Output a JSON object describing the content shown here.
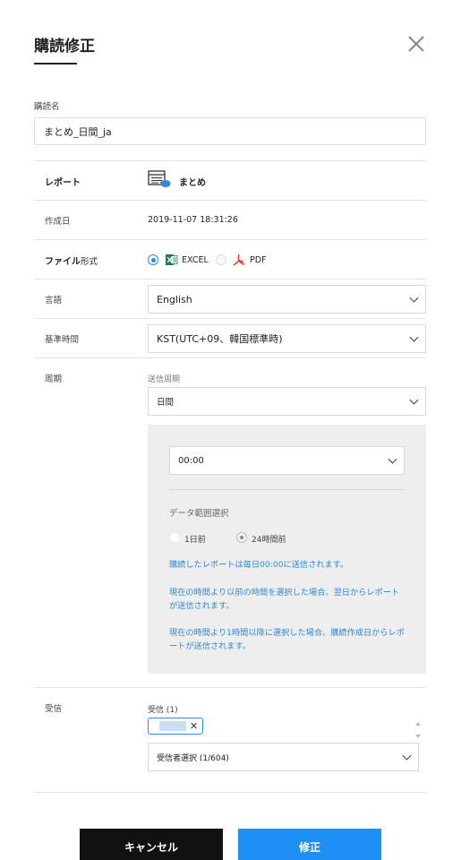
{
  "dialog": {
    "title": "購読修正"
  },
  "name_field": {
    "label": "購読名",
    "value": "まとめ_日間_ja"
  },
  "report_row": {
    "label": "レポート",
    "value": "まとめ"
  },
  "created_row": {
    "label": "作成日",
    "value": "2019-11-07 18:31:26"
  },
  "file_format_row": {
    "label_bold": "ファイル",
    "label_rest": "形式",
    "options": [
      {
        "label": "EXCEL",
        "selected": true
      },
      {
        "label": "PDF",
        "selected": false
      }
    ]
  },
  "language_row": {
    "label": "言語",
    "value": "English"
  },
  "timezone_row": {
    "label": "基準時間",
    "value": "KST(UTC+09、韓国標準時)"
  },
  "period_row": {
    "label": "周期",
    "cycle_label": "送信周期",
    "cycle_value": "日間",
    "time_value": "00:00",
    "range_label": "データ範囲選択",
    "range_options": [
      {
        "label": "1日前",
        "selected": false
      },
      {
        "label": "24時間前",
        "selected": true
      }
    ],
    "info": [
      "購読したレポートは毎日00:00に送信されます。",
      "現在の時間より以前の時間を選択した場合、翌日からレポートが送信されます。",
      "現在の時間より1時間以降に選択した場合、購読作成日からレポートが送信されます。"
    ]
  },
  "recipient_row": {
    "label": "受信",
    "count_label": "受信 (1)",
    "select_value": "受信者選択 (1/604)"
  },
  "buttons": {
    "cancel": "キャンセル",
    "submit": "修正"
  },
  "colors": {
    "accent": "#1e8ff5",
    "info_text": "#2f86d6",
    "excel_green": "#1d7a45",
    "pdf_red": "#e0352b"
  }
}
